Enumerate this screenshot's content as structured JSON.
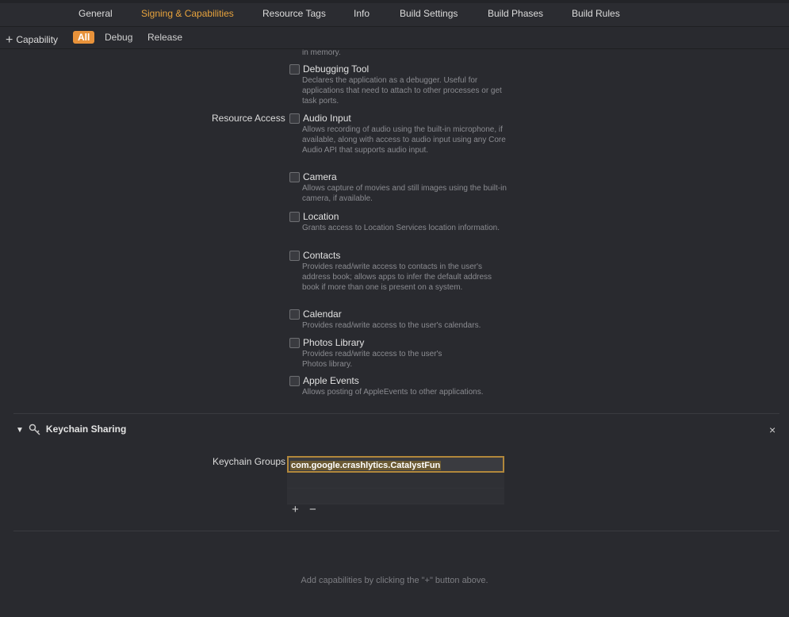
{
  "tabs": [
    "General",
    "Signing & Capabilities",
    "Resource Tags",
    "Info",
    "Build Settings",
    "Build Phases",
    "Build Rules"
  ],
  "active_tab": "Signing & Capabilities",
  "toolbar": {
    "add_capability": "Capability",
    "filters": [
      "All",
      "Debug",
      "Release"
    ],
    "active_filter": "All"
  },
  "sandbox": {
    "truncated_text": "in memory.",
    "debugging_tool": {
      "title": "Debugging Tool",
      "desc": "Declares the application as a debugger. Useful for applications that need to attach to other processes or get task ports."
    },
    "resource_access_label": "Resource Access",
    "items": [
      {
        "title": "Audio Input",
        "desc": "Allows recording of audio using the built-in microphone, if available, along with access to audio input using any Core Audio API that supports audio input."
      },
      {
        "title": "Camera",
        "desc": "Allows capture of movies and still images using the built-in camera, if available."
      },
      {
        "title": "Location",
        "desc": "Grants access to Location Services location information."
      },
      {
        "title": "Contacts",
        "desc": "Provides read/write access to contacts in the user's address book; allows apps to infer the default address book if more than one is present on a system."
      },
      {
        "title": "Calendar",
        "desc": "Provides read/write access to the user's calendars."
      },
      {
        "title": "Photos Library",
        "desc": "Provides read/write access to the user's Photos library."
      },
      {
        "title": "Apple Events",
        "desc": "Allows posting of AppleEvents to other applications."
      }
    ]
  },
  "keychain": {
    "title": "Keychain Sharing",
    "groups_label": "Keychain Groups",
    "groups": [
      "com.google.crashlytics.CatalystFun"
    ],
    "add_symbol": "+",
    "remove_symbol": "−",
    "close_symbol": "×"
  },
  "footer_message": "Add capabilities by clicking the \"+\" button above."
}
